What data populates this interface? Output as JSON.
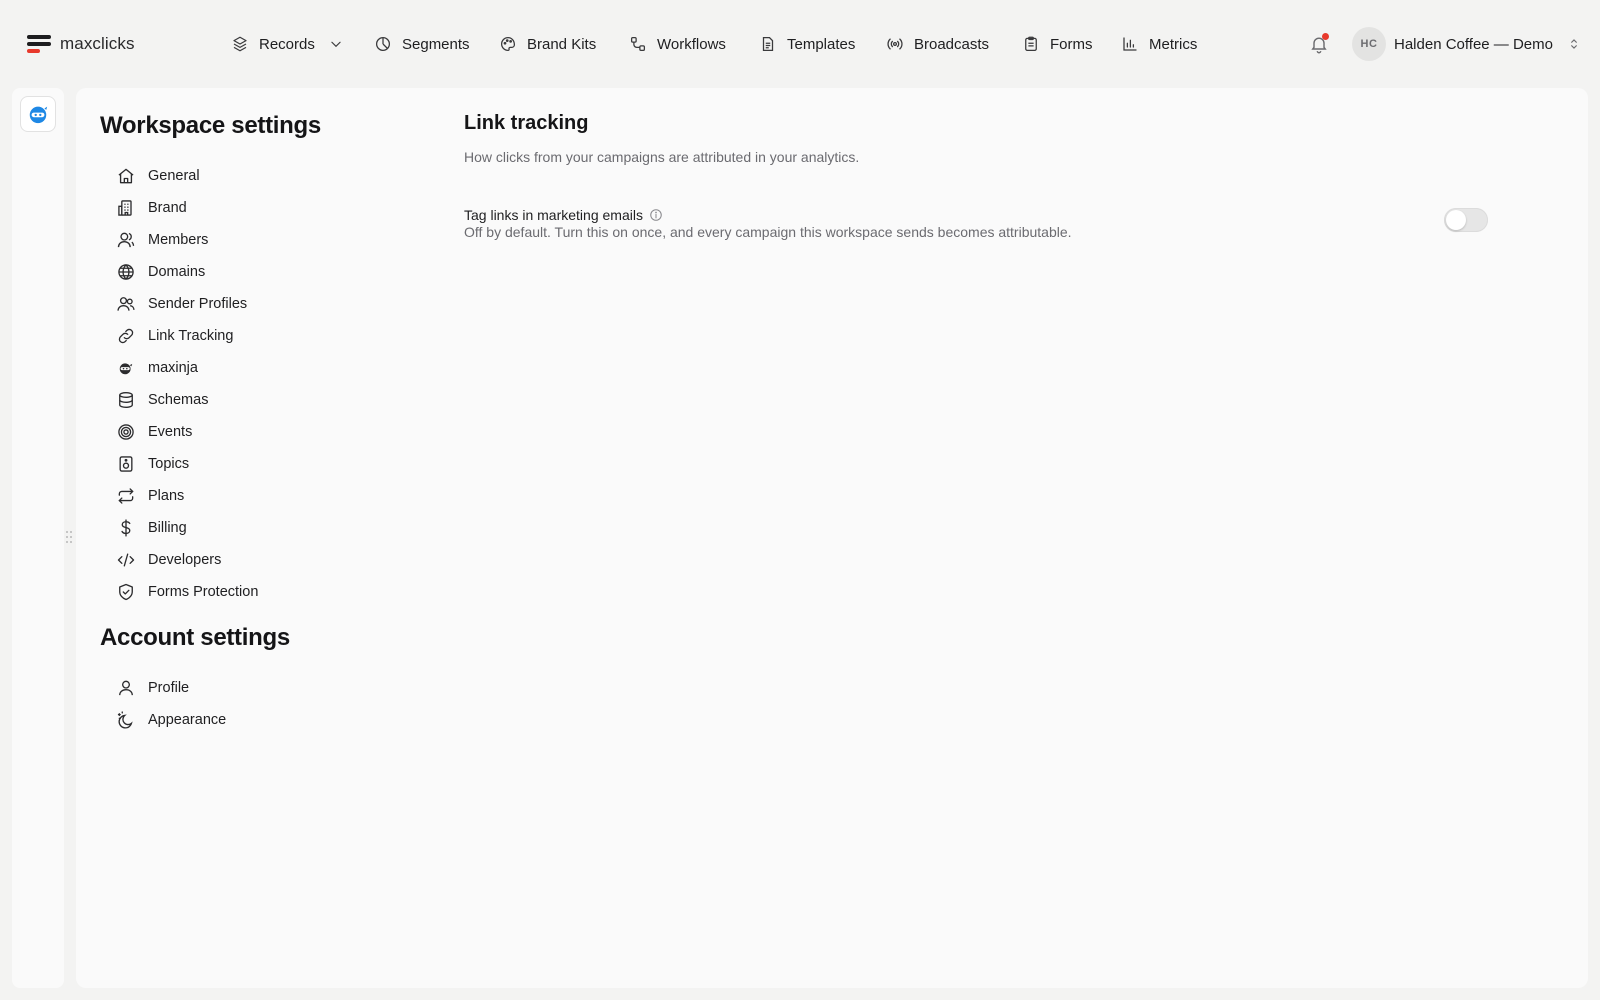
{
  "brand": {
    "name": "maxclicks",
    "accent": "#e8392c"
  },
  "nav": [
    {
      "label": "Records",
      "icon": "layers-icon",
      "has_dropdown": true
    },
    {
      "label": "Segments",
      "icon": "pie-icon"
    },
    {
      "label": "Brand Kits",
      "icon": "palette-icon"
    },
    {
      "label": "Workflows",
      "icon": "workflow-icon"
    },
    {
      "label": "Templates",
      "icon": "document-icon"
    },
    {
      "label": "Broadcasts",
      "icon": "broadcast-icon"
    },
    {
      "label": "Forms",
      "icon": "clipboard-icon"
    },
    {
      "label": "Metrics",
      "icon": "bar-chart-icon"
    }
  ],
  "notifications": {
    "icon": "bell-icon",
    "unread_dot_color": "#e8392c"
  },
  "account": {
    "initials": "HC",
    "name": "Halden Coffee — Demo"
  },
  "rail": {
    "app_icon": "ninja-bot-icon",
    "app_icon_color": "#1e88e5"
  },
  "sidebar": {
    "workspace_title": "Workspace settings",
    "workspace_items": [
      {
        "label": "General",
        "icon": "home-icon"
      },
      {
        "label": "Brand",
        "icon": "building-icon"
      },
      {
        "label": "Members",
        "icon": "user-icon"
      },
      {
        "label": "Domains",
        "icon": "globe-icon"
      },
      {
        "label": "Sender Profiles",
        "icon": "users-icon"
      },
      {
        "label": "Link Tracking",
        "icon": "link-icon"
      },
      {
        "label": "maxinja",
        "icon": "ninja-icon"
      },
      {
        "label": "Schemas",
        "icon": "database-icon"
      },
      {
        "label": "Events",
        "icon": "target-icon"
      },
      {
        "label": "Topics",
        "icon": "speaker-icon"
      },
      {
        "label": "Plans",
        "icon": "repeat-icon"
      },
      {
        "label": "Billing",
        "icon": "dollar-icon"
      },
      {
        "label": "Developers",
        "icon": "code-icon"
      },
      {
        "label": "Forms Protection",
        "icon": "shield-check-icon"
      }
    ],
    "account_title": "Account settings",
    "account_items": [
      {
        "label": "Profile",
        "icon": "user-icon"
      },
      {
        "label": "Appearance",
        "icon": "moon-icon"
      }
    ]
  },
  "content": {
    "title": "Link tracking",
    "subtitle": "How clicks from your campaigns are attributed in your analytics.",
    "setting": {
      "label": "Tag links in marketing emails",
      "description": "Off by default. Turn this on once, and every campaign this workspace sends becomes attributable.",
      "enabled": false
    }
  }
}
